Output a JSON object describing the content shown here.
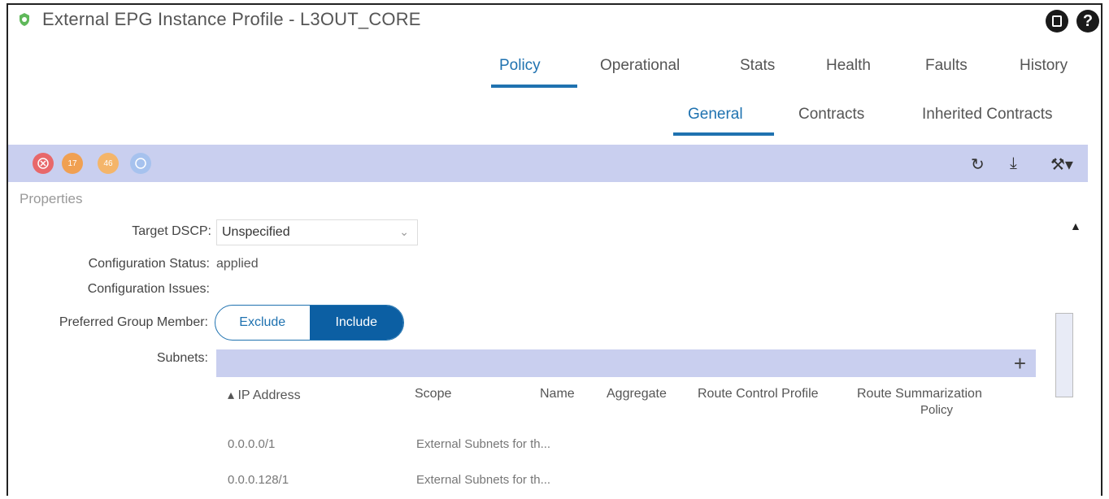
{
  "window": {
    "title": "External EPG Instance Profile - L3OUT_CORE"
  },
  "top_icons": [
    "book-icon",
    "help-icon"
  ],
  "main_tabs": [
    {
      "label": "Policy",
      "active": true
    },
    {
      "label": "Operational",
      "active": false
    },
    {
      "label": "Stats",
      "active": false
    },
    {
      "label": "Health",
      "active": false
    },
    {
      "label": "Faults",
      "active": false
    },
    {
      "label": "History",
      "active": false
    }
  ],
  "sub_tabs": [
    {
      "label": "General",
      "active": true
    },
    {
      "label": "Contracts",
      "active": false
    },
    {
      "label": "Inherited Contracts",
      "active": false
    }
  ],
  "fault_badges": [
    {
      "name": "critical-badge",
      "color": "#e8686a",
      "count": ""
    },
    {
      "name": "major-badge",
      "color": "#f0a052",
      "count": "17"
    },
    {
      "name": "minor-badge",
      "color": "#f4b56a",
      "count": "46"
    },
    {
      "name": "info-badge",
      "color": "#8fb5e6",
      "count": ""
    }
  ],
  "toolbar_icons": [
    "refresh-icon",
    "download-icon",
    "tools-icon"
  ],
  "properties": {
    "heading": "Properties",
    "target_dscp_label": "Target DSCP:",
    "target_dscp_value": "Unspecified",
    "config_status_label": "Configuration Status:",
    "config_status_value": "applied",
    "config_issues_label": "Configuration Issues:",
    "preferred_group_label": "Preferred Group Member:",
    "preferred_group_options": [
      "Exclude",
      "Include"
    ],
    "preferred_group_selected": "Include",
    "subnets_label": "Subnets:"
  },
  "subnets_table": {
    "columns": [
      "▴ IP Address",
      "Scope",
      "Name",
      "Aggregate",
      "Route Control Profile",
      "Route Summarization",
      "Policy"
    ],
    "rows": [
      {
        "ip": "0.0.0.0/1",
        "scope": "External Subnets for th..."
      },
      {
        "ip": "0.0.0.128/1",
        "scope": "External Subnets for th..."
      }
    ]
  }
}
